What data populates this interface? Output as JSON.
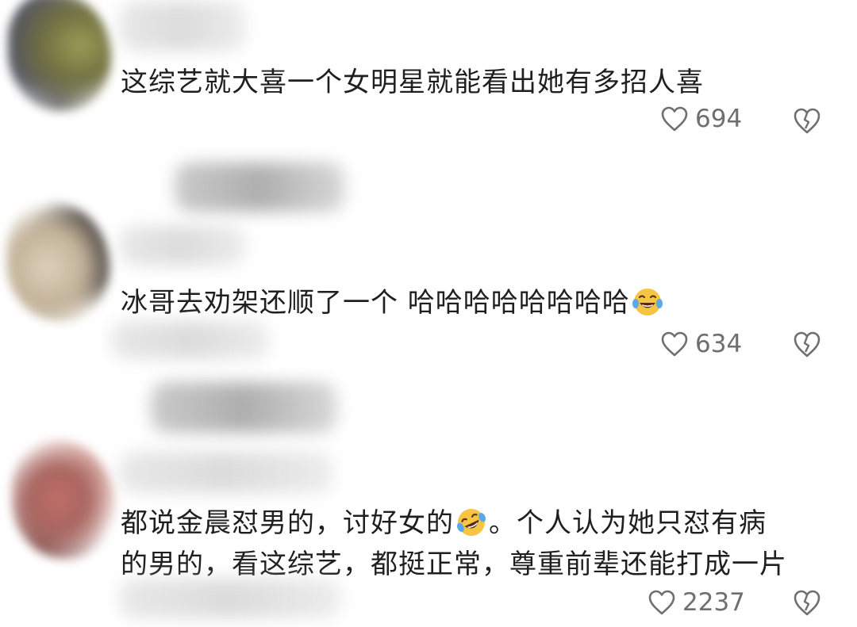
{
  "comments": [
    {
      "text": "这综艺就大喜一个女明星就能看出她有多招人喜",
      "likes": "694",
      "like_icon": "heart-outline-icon",
      "dislike_icon": "broken-heart-icon"
    },
    {
      "text": "冰哥去劝架还顺了一个 哈哈哈哈哈哈哈哈",
      "emoji": "laughing-tears-emoji",
      "likes": "634",
      "like_icon": "heart-outline-icon",
      "dislike_icon": "broken-heart-icon"
    },
    {
      "text_before_emoji": "都说金晨怼男的，讨好女的",
      "emoji": "rolling-laughing-emoji",
      "text_after_emoji": "。个人认为她只怼有病",
      "text_line2": "的男的，看这综艺，都挺正常，尊重前辈还能打成一片",
      "likes": "2237",
      "like_icon": "heart-outline-icon",
      "dislike_icon": "broken-heart-icon"
    }
  ],
  "colors": {
    "text": "#1f1f1f",
    "meta": "#6f6f6f",
    "emoji_yellow": "#f6c544",
    "emoji_tear": "#5aa9e6"
  }
}
